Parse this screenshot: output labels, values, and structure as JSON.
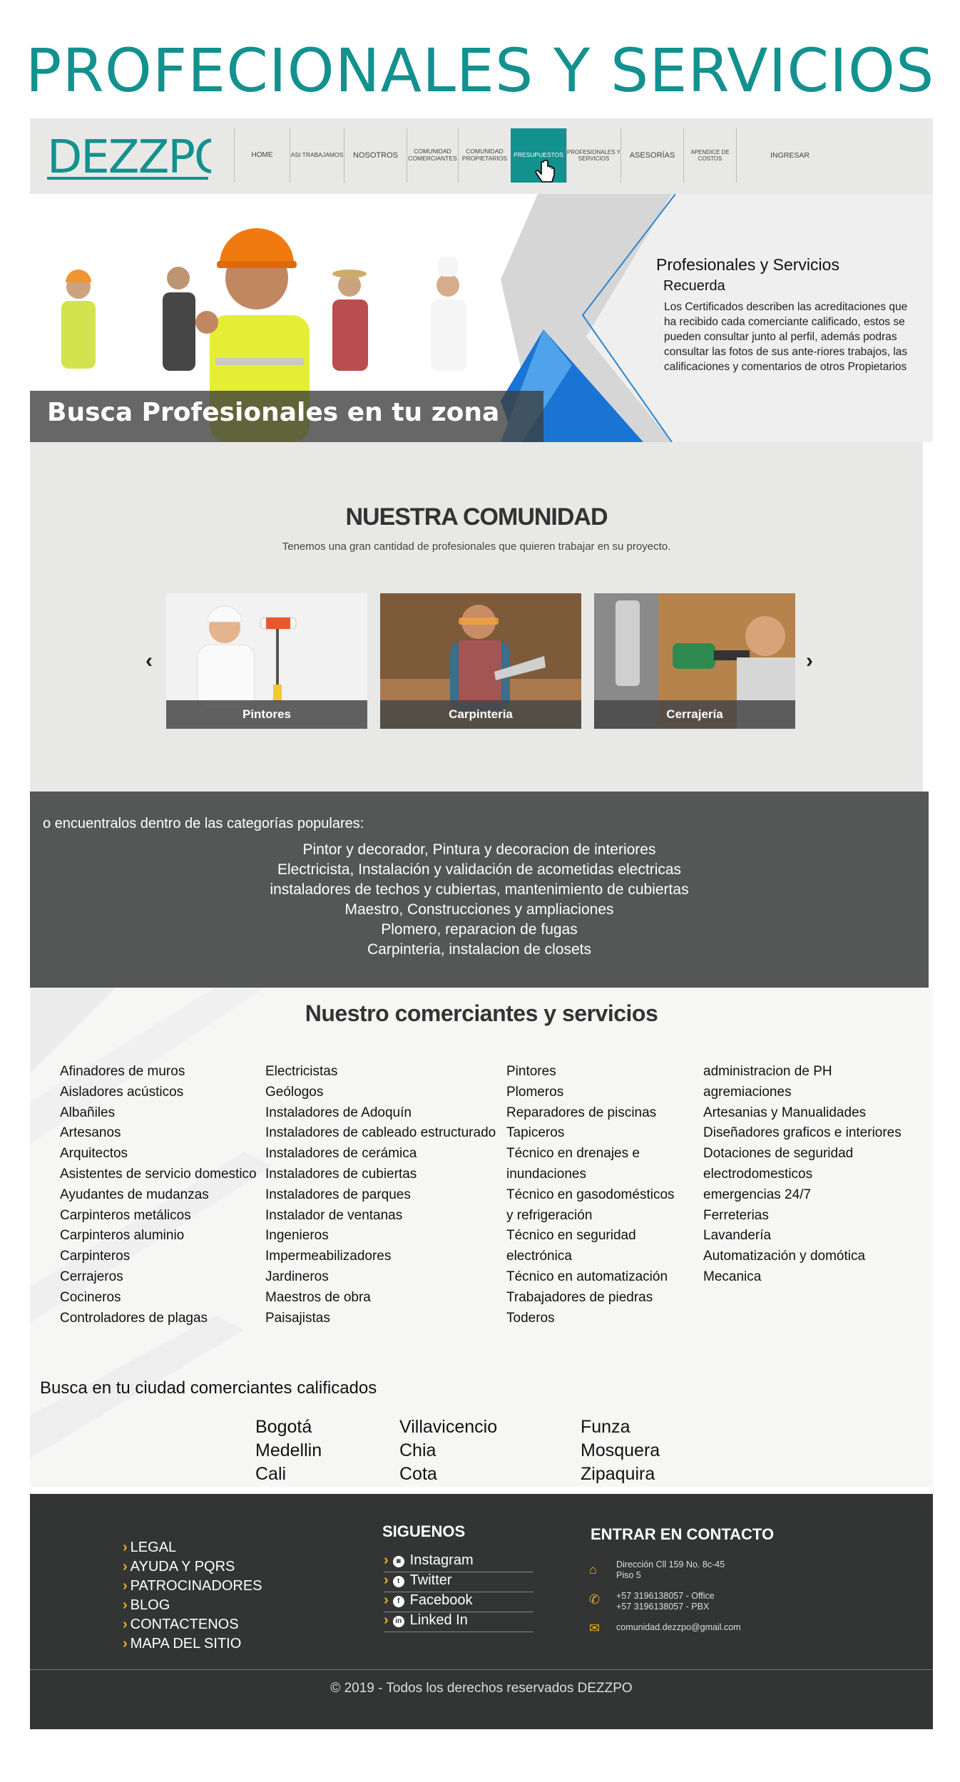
{
  "page": {
    "title": "PROFECIONALES Y SERVICIOS"
  },
  "brand": {
    "logo_text": "DEZZPO",
    "accent": "#13918f",
    "gold": "#e7b21c"
  },
  "nav": {
    "items": [
      {
        "label": "HOME"
      },
      {
        "label": "ASI TRABAJAMOS"
      },
      {
        "label": "NOSOTROS"
      },
      {
        "label": "COMUNIDAD COMERCIANTES"
      },
      {
        "label": "COMUNIDAD PROPIETARIOS"
      },
      {
        "label": "PRESUPUESTOS",
        "active": true
      },
      {
        "label": "PROFESIONALES Y SERVICIOS"
      },
      {
        "label": "ASESORÍAS"
      },
      {
        "label": "APENDICE DE COSTOS"
      },
      {
        "label": "INGRESAR"
      }
    ]
  },
  "hero": {
    "caption": "Busca Profesionales en tu zona",
    "title": "Profesionales y Servicios",
    "subtitle": "Recuerda",
    "body": "Los Certificados describen las acreditaciones que ha recibido cada comerciante calificado, estos se pueden consultar junto al perfil, además podras consultar las fotos de sus ante-riores trabajos, las calificaciones y comentarios de otros Propietarios"
  },
  "community": {
    "title": "NUESTRA COMUNIDAD",
    "subtitle": "Tenemos una gran cantidad de profesionales que quieren trabajar en su proyecto.",
    "cards": [
      {
        "label": "Pintores"
      },
      {
        "label": "Carpinteria"
      },
      {
        "label": "Cerrajería"
      }
    ]
  },
  "categories": {
    "intro": "o encuentralos dentro de las categorías populares:",
    "lines": [
      "Pintor y decorador, Pintura y decoracion de interiores",
      "Electricista, Instalación y validación de acometidas electricas",
      "instaladores de techos y cubiertas, mantenimiento de cubiertas",
      "Maestro, Construcciones y ampliaciones",
      "Plomero, reparacion de fugas",
      "Carpinteria, instalacion de closets"
    ]
  },
  "merchants": {
    "title": "Nuestro comerciantes y servicios",
    "columns": [
      [
        "Afinadores de muros",
        "Aisladores acústicos",
        "Albañiles",
        "Artesanos",
        "Arquitectos",
        "Asistentes de servicio domestico",
        "Ayudantes de mudanzas",
        "Carpinteros metálicos",
        "Carpinteros aluminio",
        "Carpinteros",
        "Cerrajeros",
        "Cocineros",
        "Controladores de plagas"
      ],
      [
        "Electricistas",
        "Geólogos",
        "Instaladores de Adoquín",
        "Instaladores de cableado estructurado",
        "Instaladores de cerámica",
        "Instaladores de cubiertas",
        "Instaladores de parques",
        "Instalador de ventanas",
        "Ingenieros",
        "Impermeabilizadores",
        "Jardineros",
        "Maestros de obra",
        "Paisajistas"
      ],
      [
        "Pintores",
        "Plomeros",
        "Reparadores de piscinas",
        "Tapiceros",
        "Técnico en drenajes e",
        "inundaciones",
        "Técnico en gasodomésticos",
        "y refrigeración",
        "Técnico en seguridad",
        "electrónica",
        "Técnico en automatización",
        "Trabajadores de piedras",
        "Toderos"
      ],
      [
        "administracion de PH",
        "agremiaciones",
        "Artesanias y Manualidades",
        "Diseñadores graficos e interiores",
        "Dotaciones de seguridad",
        "electrodomesticos",
        "emergencias 24/7",
        "Ferreterias",
        "Lavandería",
        "Automatización y domótica",
        "Mecanica"
      ]
    ],
    "cities_title": "Busca en tu ciudad comerciantes calificados",
    "cities": [
      [
        "Bogotá",
        "Medellin",
        "Cali"
      ],
      [
        "Villavicencio",
        "Chia",
        "Cota"
      ],
      [
        "Funza",
        "Mosquera",
        "Zipaquira"
      ]
    ]
  },
  "footer": {
    "links": [
      "LEGAL",
      "AYUDA Y PQRS",
      "PATROCINADORES",
      "BLOG",
      "CONTACTENOS",
      "MAPA DEL SITIO"
    ],
    "social_title": "SIGUENOS",
    "social": [
      {
        "label": "Instagram",
        "icon": "instagram-icon",
        "glyph": "◙"
      },
      {
        "label": "Twitter",
        "icon": "twitter-icon",
        "glyph": "t"
      },
      {
        "label": "Facebook",
        "icon": "facebook-icon",
        "glyph": "f"
      },
      {
        "label": "Linked In",
        "icon": "linkedin-icon",
        "glyph": "in"
      }
    ],
    "contact_title": "ENTRAR EN CONTACTO",
    "address_1": "Dirección Cll 159 No. 8c-45",
    "address_2": "Piso 5",
    "phone_1": "+57 3196138057 - Office",
    "phone_2": "+57 3196138057 - PBX",
    "email": "comunidad.dezzpo@gmail.com",
    "copyright": "© 2019 - Todos los derechos reservados DEZZPO"
  }
}
